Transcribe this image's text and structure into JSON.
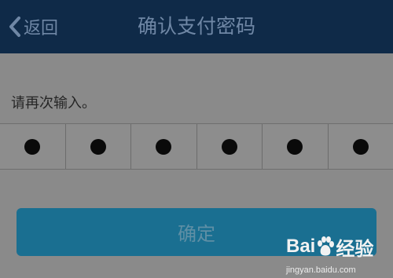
{
  "navbar": {
    "back_label": "返回",
    "title": "确认支付密码"
  },
  "prompt": "请再次输入。",
  "pin": {
    "length": 6,
    "filled": 6
  },
  "confirm_button": "确定",
  "watermark": {
    "brand": "Bai du 经验",
    "url": "jingyan.baidu.com"
  },
  "colors": {
    "navbar": "#0f2a48",
    "background": "#8a8a8a",
    "button": "#1a6f91"
  }
}
